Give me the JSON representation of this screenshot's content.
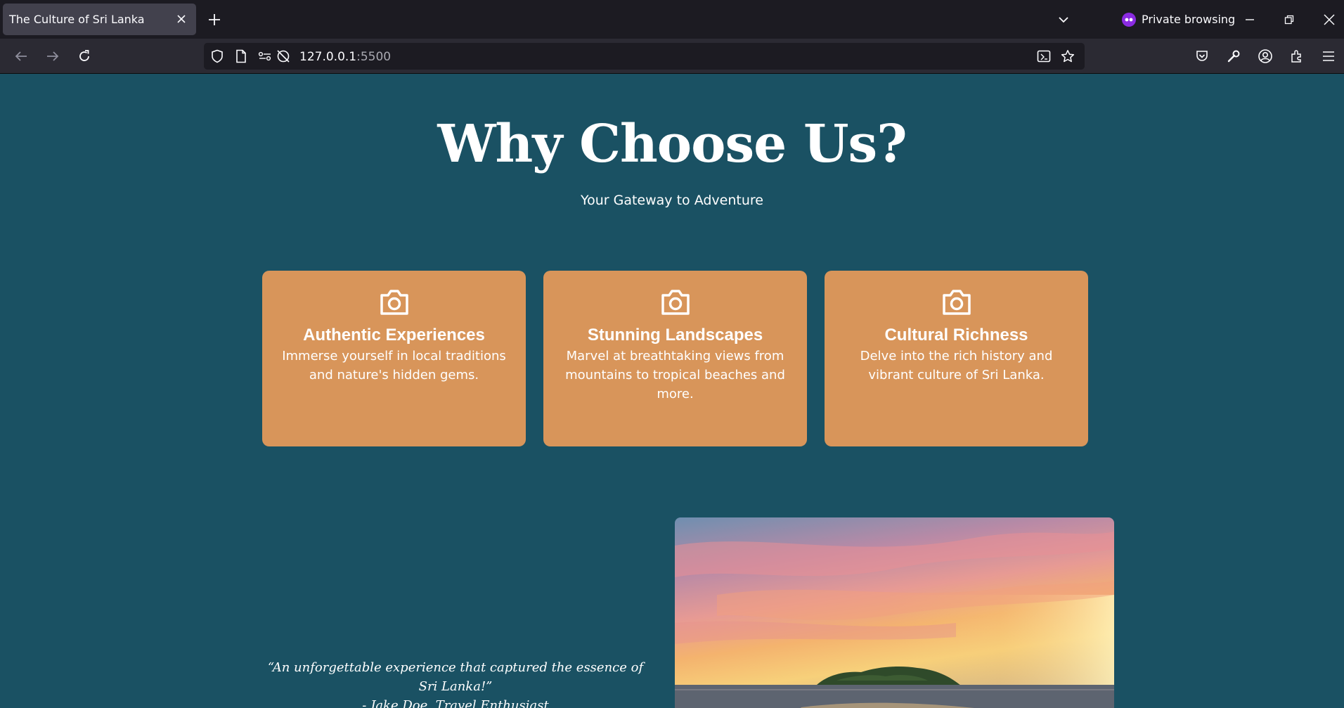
{
  "browser": {
    "tab_title": "The Culture of Sri Lanka",
    "private_label": "Private browsing",
    "url_host": "127.0.0.1",
    "url_port": ":5500"
  },
  "hero": {
    "title": "Why Choose Us?",
    "subtitle": "Your Gateway to Adventure"
  },
  "features": [
    {
      "icon": "camera-icon",
      "title": "Authentic Experiences",
      "description": "Immerse yourself in local traditions and nature's hidden gems."
    },
    {
      "icon": "camera-icon",
      "title": "Stunning Landscapes",
      "description": "Marvel at breathtaking views from mountains to tropical beaches and more."
    },
    {
      "icon": "camera-icon",
      "title": "Cultural Richness",
      "description": "Delve into the rich history and vibrant culture of Sri Lanka."
    }
  ],
  "testimonial": {
    "quote": "“An unforgettable experience that captured the essence of Sri Lanka!”",
    "author": "- Jake Doe, Travel Enthusiast"
  },
  "colors": {
    "page_background": "#1a5163",
    "card_background": "#d8955a",
    "text": "#ffffff"
  }
}
